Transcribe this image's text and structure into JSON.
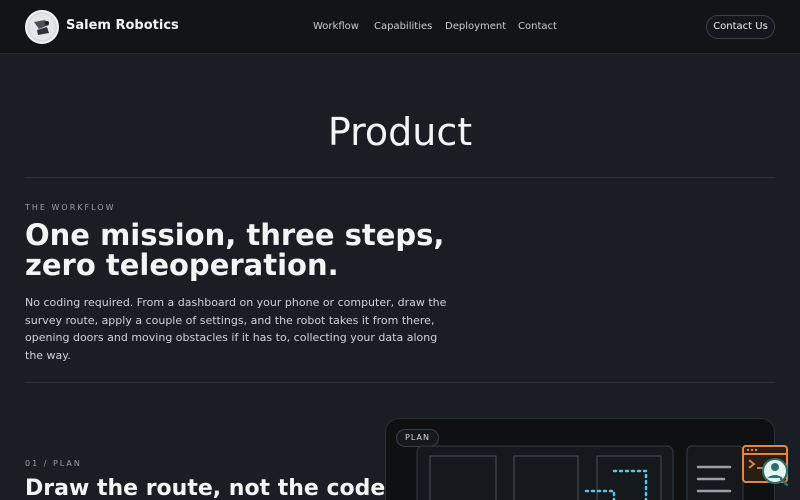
{
  "header": {
    "brand": "Salem Robotics",
    "nav": [
      "Workflow",
      "Capabilities",
      "Deployment",
      "Contact"
    ],
    "cta": "Contact Us"
  },
  "hero": {
    "title": "Product"
  },
  "workflow": {
    "eyebrow": "THE WORKFLOW",
    "headline": "One mission, three steps, zero teleoperation.",
    "body": "No coding required. From a dashboard on your phone or computer, draw the survey route, apply a couple of settings, and the robot takes it from there, opening doors and moving obstacles if it has to, collecting your data along the way."
  },
  "step": {
    "eyebrow": "01 / PLAN",
    "title": "Draw the route, not the code.",
    "badge": "PLAN"
  },
  "colors": {
    "accent_orange": "#e0884a",
    "accent_teal": "#5fc3e0",
    "background": "#1a1d23"
  },
  "icons": [
    "robot-logo-icon",
    "menu-lines-icon",
    "help-chat-icon"
  ]
}
